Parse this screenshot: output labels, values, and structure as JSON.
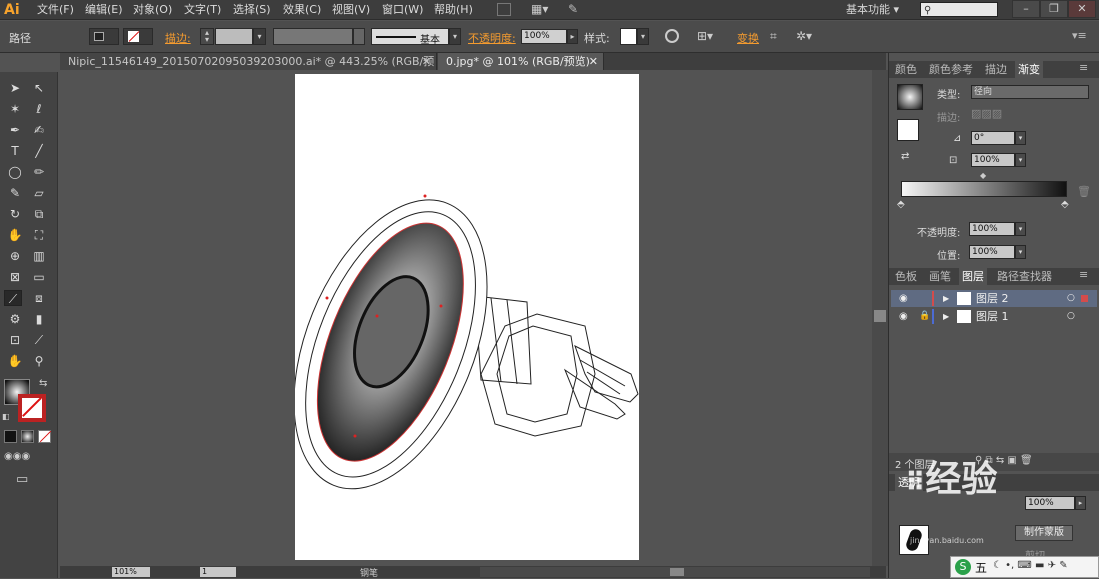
{
  "app": {
    "logo": "Ai"
  },
  "menu": [
    "文件(F)",
    "编辑(E)",
    "对象(O)",
    "文字(T)",
    "选择(S)",
    "效果(C)",
    "视图(V)",
    "窗口(W)",
    "帮助(H)"
  ],
  "workspace": "基本功能",
  "control_bar": {
    "mode_label": "路径",
    "stroke_label": "描边:",
    "stroke_style": "基本",
    "opacity_label": "不透明度:",
    "opacity_value": "100%",
    "style_label": "样式:",
    "transform_label": "变换"
  },
  "tabs": [
    {
      "label": "Nipic_11546149_20150702095039203000.ai* @ 443.25% (RGB/预览)",
      "active": false
    },
    {
      "label": "0.jpg* @ 101% (RGB/预览)",
      "active": true
    }
  ],
  "gradient_panel": {
    "tabs": [
      "颜色",
      "颜色参考",
      "描边",
      "渐变"
    ],
    "active_tab": "渐变",
    "type_label": "类型:",
    "type_value": "径向",
    "stroke_label": "描边:",
    "angle_value": "0°",
    "aspect_value": "100%",
    "opacity_label": "不透明度:",
    "opacity_value": "100%",
    "location_label": "位置:",
    "location_value": "100%"
  },
  "layers_panel": {
    "tabs": [
      "色板",
      "画笔",
      "图层",
      "路径查找器"
    ],
    "active_tab": "图层",
    "layers": [
      {
        "name": "图层 2",
        "color": "#d34c4c",
        "selected": true
      },
      {
        "name": "图层 1",
        "color": "#4c6bd3",
        "selected": false
      }
    ],
    "count_label": "2 个图层"
  },
  "bottom_panel": {
    "partial_tab": "透明",
    "opacity_value": "100%",
    "button_label": "制作蒙版",
    "clip_label": "剪切"
  },
  "status": {
    "zoom": "101%",
    "page": "1",
    "tool": "钢笔"
  },
  "watermark": {
    "text": "经验",
    "sub": "jingyan.baidu.com"
  },
  "ime": {
    "label": "五"
  }
}
